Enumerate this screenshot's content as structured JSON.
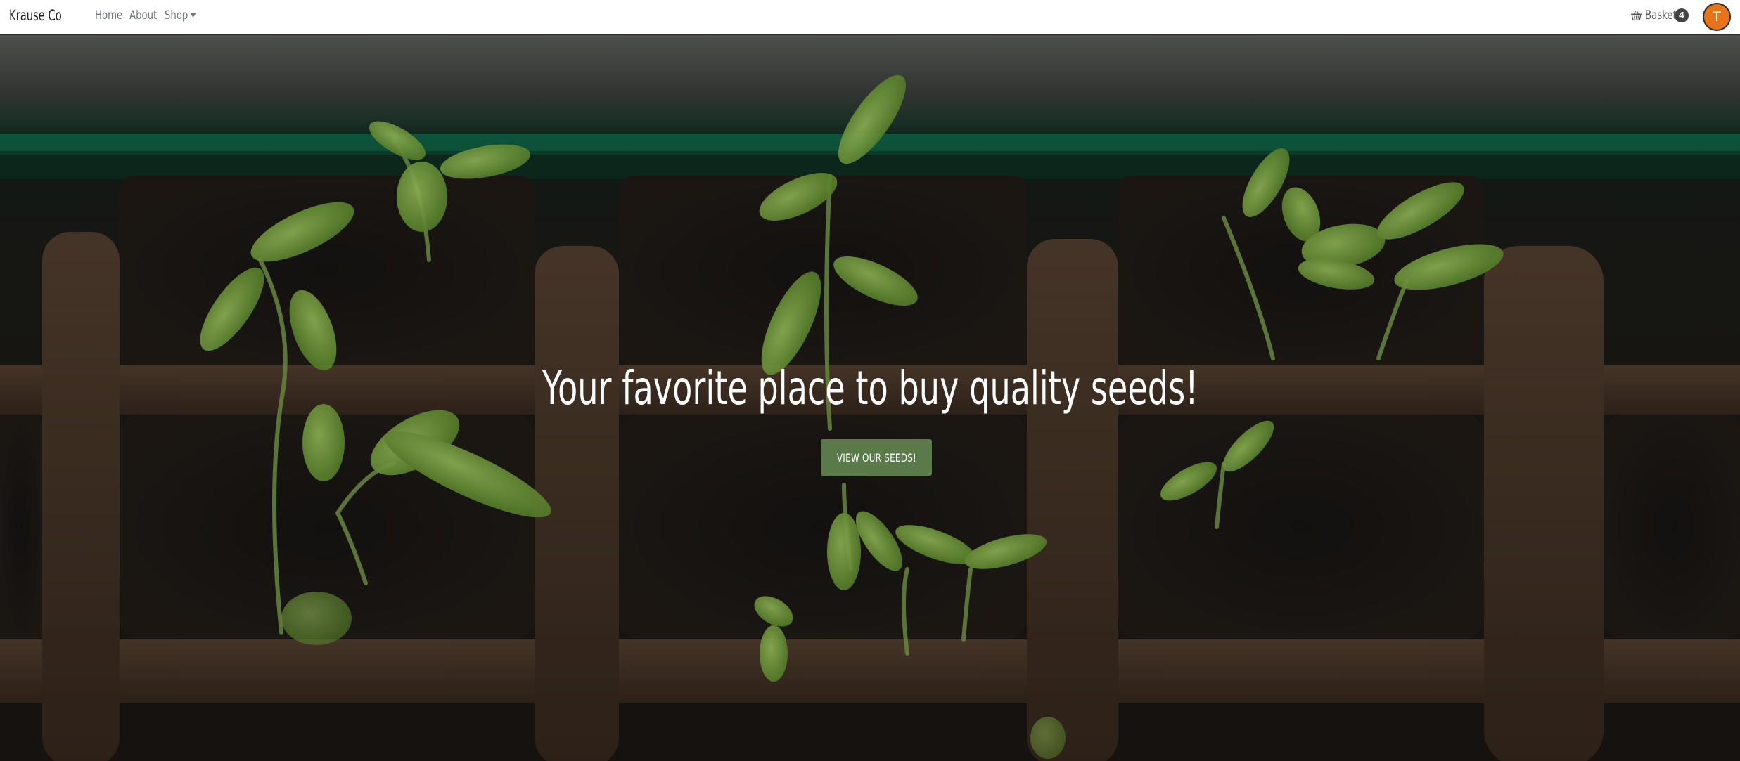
{
  "navbar": {
    "brand": "Krause Co",
    "links": {
      "home": "Home",
      "about": "About",
      "shop": "Shop"
    },
    "basket": {
      "label": "Basket",
      "count": "4",
      "icon": "basket-icon"
    },
    "avatar_initial": "T"
  },
  "hero": {
    "title": "Your favorite place to buy quality seeds!",
    "button_label": "VIEW OUR SEEDS!",
    "button_color": "#5a7a4a"
  },
  "colors": {
    "avatar": "#e8741a",
    "navbar_bg": "#ffffff"
  }
}
